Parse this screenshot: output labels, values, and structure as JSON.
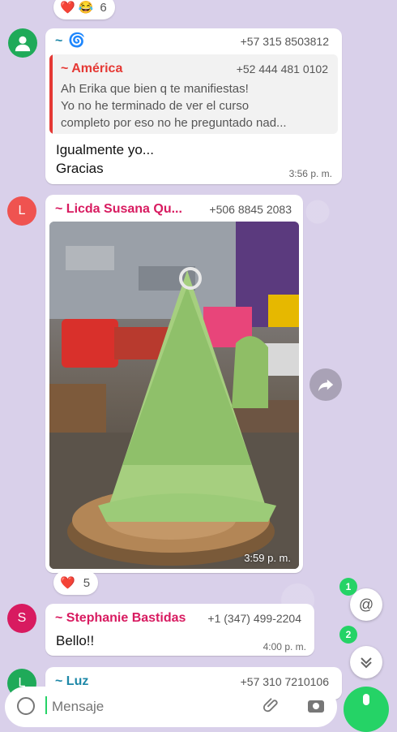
{
  "top_reaction": {
    "emojis": [
      "❤️",
      "😂"
    ],
    "count": "6"
  },
  "message1": {
    "sender": "~",
    "sender_emoji": "🌀",
    "phone": "+57 315 8503812",
    "quote": {
      "sender": "~ América",
      "phone": "+52 444 481 0102",
      "lines": [
        "Ah Erika que bien q te manifiestas!",
        "Yo no he terminado de ver el curso",
        "completo por eso no he preguntado nad..."
      ]
    },
    "lines": [
      "Igualmente yo...",
      "Gracias"
    ],
    "time": "3:56 p. m."
  },
  "message2": {
    "avatar_letter": "L",
    "sender": "~ Licda Susana Qu...",
    "phone": "+506 8845 2083",
    "time": "3:59 p. m.",
    "reaction": {
      "emoji": "❤️",
      "count": "5"
    }
  },
  "message3": {
    "avatar_letter": "S",
    "sender": "~ Stephanie Bastidas",
    "phone": "+1 (347) 499-2204",
    "text": "Bello!!",
    "time": "4:00 p. m."
  },
  "message4": {
    "avatar_letter": "L",
    "sender": "~ Luz",
    "phone": "+57 310 7210106"
  },
  "fabs": {
    "mention_count": "1",
    "mention_symbol": "@",
    "scroll_count": "2"
  },
  "composer": {
    "placeholder": "Mensaje"
  },
  "colors": {
    "america": "#e53935",
    "susana": "#d81b60",
    "stephanie": "#d81b60",
    "luz": "#1e88a8",
    "green": "#25d366",
    "avatar_l": "#ef5350",
    "avatar_s": "#d81b60"
  }
}
